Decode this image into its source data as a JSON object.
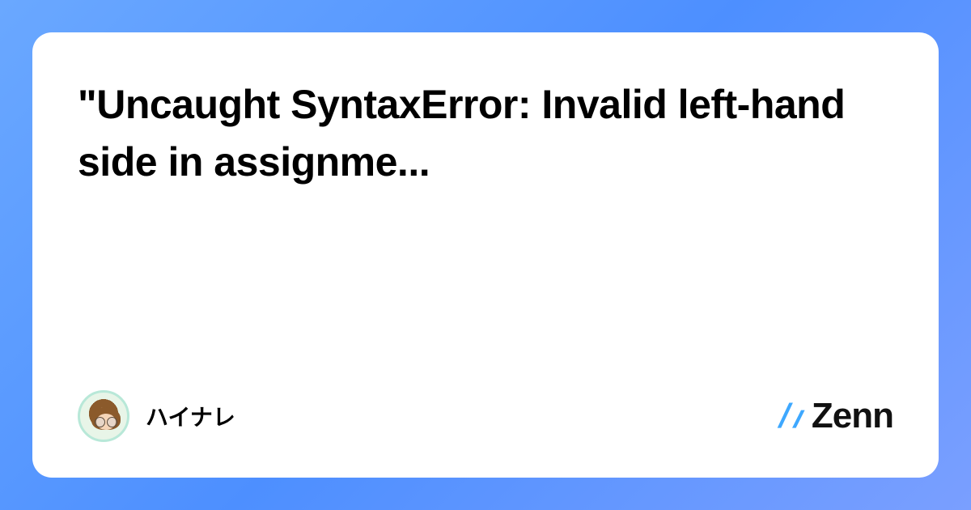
{
  "title": "\"Uncaught SyntaxError: Invalid left-hand side in assignme...",
  "author": {
    "name": "ハイナレ"
  },
  "brand": {
    "name": "Zenn"
  }
}
